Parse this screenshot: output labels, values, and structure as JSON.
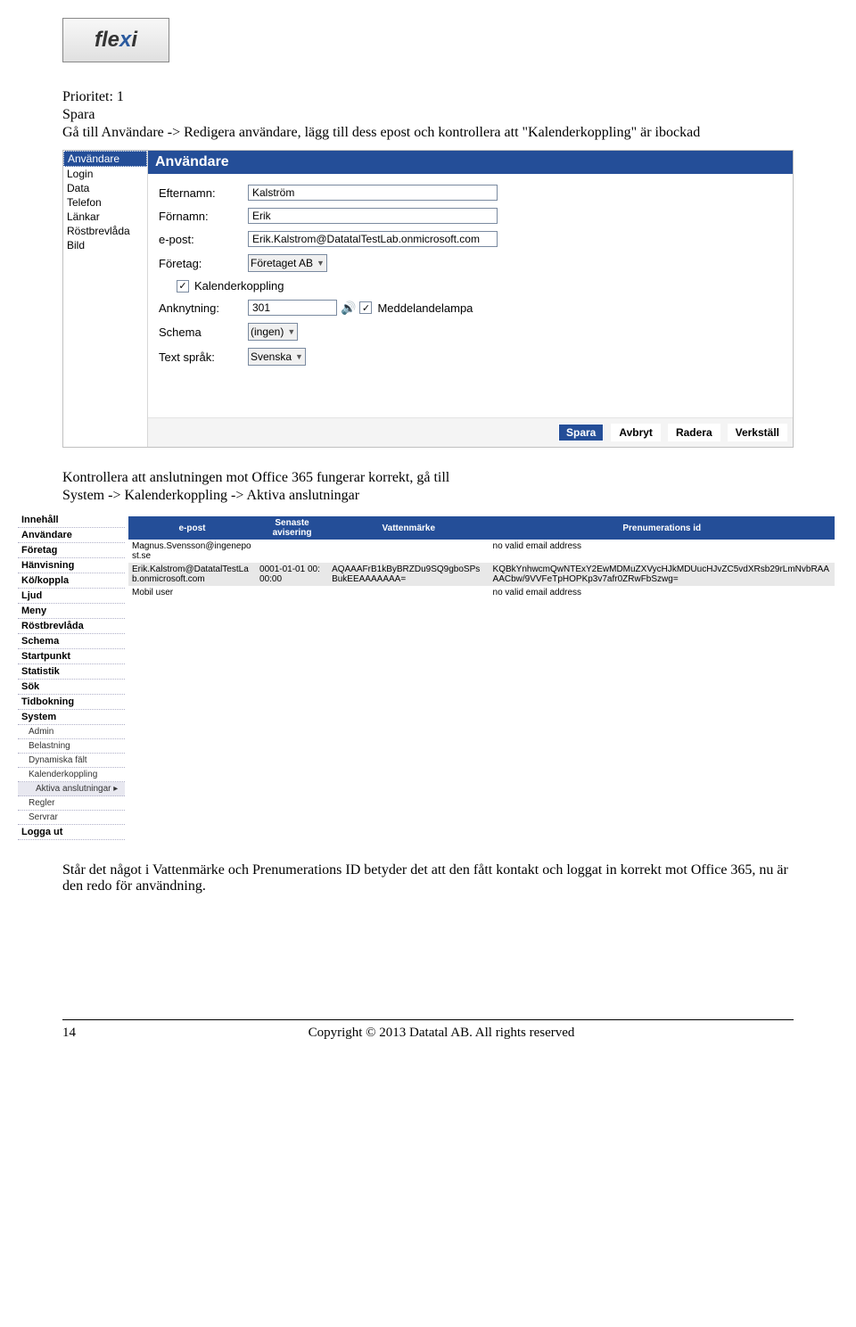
{
  "logo": "flexi",
  "intro": {
    "line1": "Prioritet: 1",
    "line2": "Spara",
    "line3": "Gå till Användare -> Redigera användare, lägg till dess epost och kontrollera att \"Kalenderkoppling\" är ibockad"
  },
  "screenshot1": {
    "nav": [
      "Användare",
      "Login",
      "Data",
      "Telefon",
      "Länkar",
      "Röstbrevlåda",
      "Bild"
    ],
    "header": "Användare",
    "fields": {
      "efternamn_label": "Efternamn:",
      "efternamn_value": "Kalström",
      "fornamn_label": "Förnamn:",
      "fornamn_value": "Erik",
      "epost_label": "e-post:",
      "epost_value": "Erik.Kalstrom@DatatalTestLab.onmicrosoft.com",
      "foretag_label": "Företag:",
      "foretag_value": "Företaget AB",
      "kalender_label": "Kalenderkoppling",
      "anknytning_label": "Anknytning:",
      "anknytning_value": "301",
      "meddelande_label": "Meddelandelampa",
      "schema_label": "Schema",
      "schema_value": "(ingen)",
      "sprak_label": "Text språk:",
      "sprak_value": "Svenska"
    },
    "buttons": {
      "spara": "Spara",
      "avbryt": "Avbryt",
      "radera": "Radera",
      "verkstall": "Verkställ"
    }
  },
  "mid_text": {
    "line1": "Kontrollera att anslutningen mot Office 365 fungerar korrekt, gå till",
    "line2": "System -> Kalenderkoppling -> Aktiva anslutningar"
  },
  "screenshot2": {
    "nav": [
      "Innehåll",
      "Användare",
      "Företag",
      "Hänvisning",
      "Kö/koppla",
      "Ljud",
      "Meny",
      "Röstbrevlåda",
      "Schema",
      "Startpunkt",
      "Statistik",
      "Sök",
      "Tidbokning",
      "System"
    ],
    "nav_sub": [
      "Admin",
      "Belastning",
      "Dynamiska fält",
      "Kalenderkoppling",
      "Aktiva anslutningar ▸",
      "Regler",
      "Servrar"
    ],
    "nav_bottom": "Logga ut",
    "columns": [
      "e-post",
      "Senaste avisering",
      "Vattenmärke",
      "Prenumerations id"
    ],
    "rows": [
      {
        "epost": "Magnus.Svensson@ingenepost.se",
        "avisering": "",
        "vatten": "",
        "pren": "no valid email address"
      },
      {
        "epost": "Erik.Kalstrom@DatatalTestLab.onmicrosoft.com",
        "avisering": "0001-01-01 00:00:00",
        "vatten": "AQAAAFrB1kByBRZDu9SQ9gboSPsBukEEAAAAAAA=",
        "pren": "KQBkYnhwcmQwNTExY2EwMDMuZXVycHJkMDUucHJvZC5vdXRsb29rLmNvbRAAAACbw/9VVFeTpHOPKp3v7afr0ZRwFbSzwg="
      },
      {
        "epost": "Mobil user",
        "avisering": "",
        "vatten": "",
        "pren": "no valid email address"
      }
    ]
  },
  "end_text": "Står det något i Vattenmärke och Prenumerations ID betyder det att den fått kontakt och loggat in korrekt mot Office 365, nu är den redo för användning.",
  "footer": {
    "page": "14",
    "copyright": "Copyright © 2013 Datatal AB. All rights reserved"
  }
}
